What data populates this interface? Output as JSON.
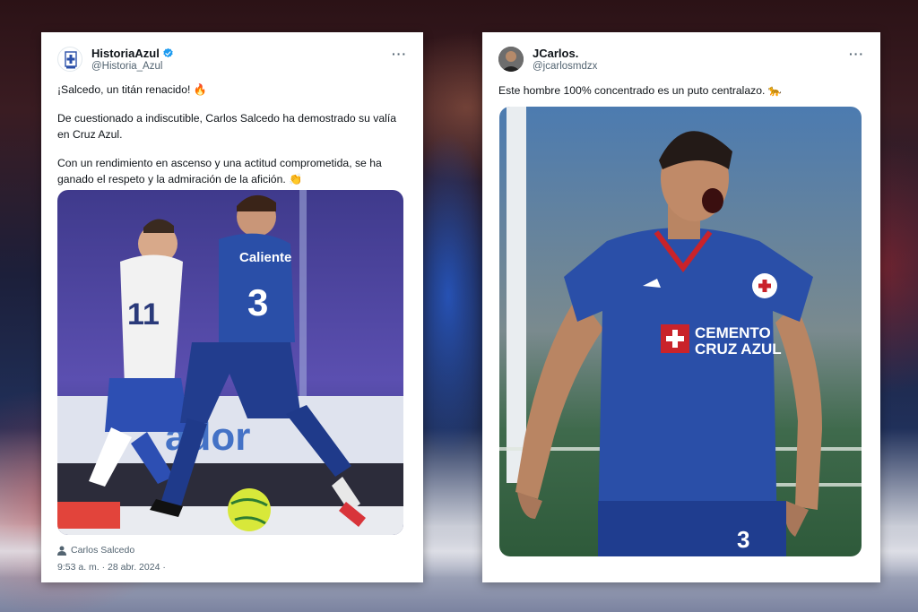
{
  "tweet_left": {
    "display_name": "HistoriaAzul",
    "handle": "@Historia_Azul",
    "more": "···",
    "line1": "¡Salcedo, un titán renacido! 🔥",
    "line2": "De cuestionado a indiscutible, Carlos Salcedo ha demostrado su valía en Cruz Azul.",
    "line3": "Con un rendimiento en ascenso y una actitud comprometida, se ha ganado el respeto y la admiración de la afición. 👏",
    "tagged_user": "Carlos Salcedo",
    "timestamp": "9:53 a. m. · 28 abr. 2024 ·",
    "photo": {
      "player_number": "3",
      "opponent_number": "11",
      "sponsor": "Caliente",
      "board_text": "ador"
    }
  },
  "tweet_right": {
    "display_name": "JCarlos.",
    "handle": "@jcarlosmdzx",
    "more": "···",
    "line1": "Este hombre 100% concentrado es un puto centralazo. 🐆",
    "photo": {
      "sponsor_line1": "CEMENTO",
      "sponsor_line2": "CRUZ AZUL",
      "shorts_number": "3"
    }
  },
  "colors": {
    "cruz_azul_blue": "#2a4fa8",
    "verified_blue": "#1d9bf0",
    "text_primary": "#0f1419",
    "text_secondary": "#536471"
  }
}
